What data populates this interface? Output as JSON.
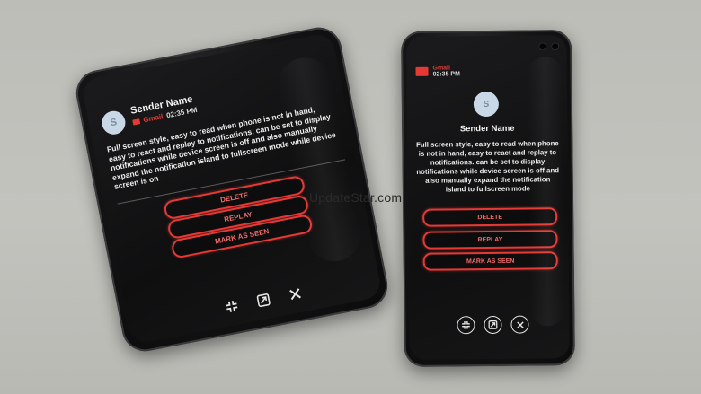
{
  "watermark": "UpdateStar.com",
  "left_phone": {
    "avatar_initial": "S",
    "sender": "Sender Name",
    "app_name": "Gmail",
    "time": "02:35 PM",
    "message": "Full screen style, easy to read when phone is not in hand, easy to react and replay to notifications. can be set to display notifications while device screen is off and also manually expand the notification island to fullscreen mode while device screen is on",
    "buttons": [
      "DELETE",
      "REPLAY",
      "MARK AS SEEN"
    ],
    "actions": [
      "collapse-icon",
      "expand-icon",
      "close-icon"
    ]
  },
  "right_phone": {
    "app_name": "Gmail",
    "time": "02:35 PM",
    "avatar_initial": "S",
    "sender": "Sender Name",
    "message": "Full screen style, easy to read when phone is not in hand, easy to react and replay to notifications. can be set to display notifications while device screen is off and also manually expand the notification island to fullscreen mode",
    "buttons": [
      "DELETE",
      "REPLAY",
      "MARK AS SEEN"
    ],
    "actions": [
      "collapse-icon",
      "expand-icon",
      "close-icon"
    ]
  },
  "colors": {
    "accent": "#e53935",
    "background": "#c0c0bb",
    "phone": "#111112"
  }
}
